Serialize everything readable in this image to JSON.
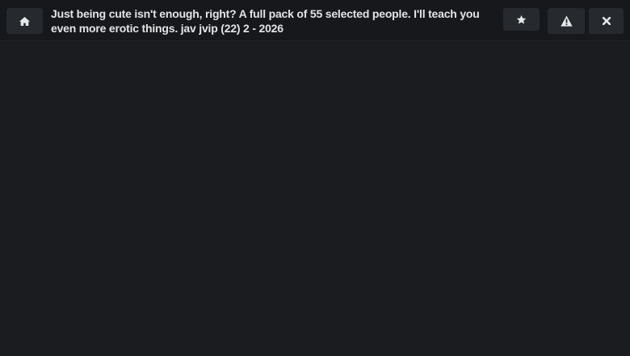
{
  "header": {
    "title": "Just being cute isn't enough, right? A full pack of 55 selected people. I'll teach you even more erotic things. jav jvip (22) 2 - 2026",
    "buttons": [
      {
        "name": "home",
        "icon": "home-icon"
      },
      {
        "name": "favorite",
        "icon": "star-icon"
      },
      {
        "name": "report",
        "icon": "warning-icon"
      },
      {
        "name": "close",
        "icon": "close-icon"
      }
    ]
  },
  "colors": {
    "background": "#1a1c20",
    "header_background": "#16181b",
    "button_background": "#26292d",
    "text": "#e3e4e6"
  }
}
